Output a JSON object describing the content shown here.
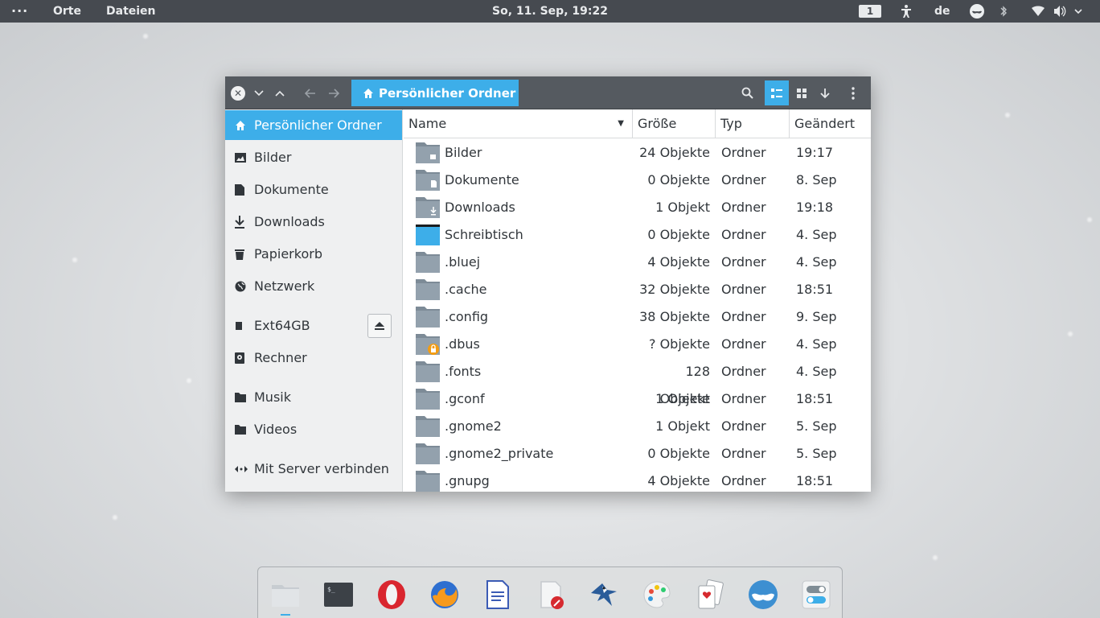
{
  "topbar": {
    "dots": "···",
    "places": "Orte",
    "files": "Dateien",
    "clock": "So, 11. Sep, 19:22",
    "workspace": "1",
    "language": "de"
  },
  "window": {
    "breadcrumb": "Persönlicher Ordner"
  },
  "sidebar": {
    "items": [
      {
        "label": "Persönlicher Ordner",
        "icon": "home-icon"
      },
      {
        "label": "Bilder",
        "icon": "image-icon"
      },
      {
        "label": "Dokumente",
        "icon": "document-icon"
      },
      {
        "label": "Downloads",
        "icon": "download-icon"
      },
      {
        "label": "Papierkorb",
        "icon": "trash-icon"
      },
      {
        "label": "Netzwerk",
        "icon": "network-icon"
      },
      {
        "label": "Ext64GB",
        "icon": "drive-icon"
      },
      {
        "label": "Rechner",
        "icon": "computer-icon"
      },
      {
        "label": "Musik",
        "icon": "folder-icon"
      },
      {
        "label": "Videos",
        "icon": "folder-icon"
      },
      {
        "label": "Mit Server verbinden",
        "icon": "connect-icon"
      }
    ]
  },
  "columns": {
    "name": "Name",
    "size": "Größe",
    "type": "Typ",
    "modified": "Geändert"
  },
  "rows": [
    {
      "name": "Bilder",
      "size": "24 Objekte",
      "type": "Ordner",
      "modified": "19:17",
      "icon": "pictures-folder-icon"
    },
    {
      "name": "Dokumente",
      "size": "0 Objekte",
      "type": "Ordner",
      "modified": "8. Sep",
      "icon": "documents-folder-icon"
    },
    {
      "name": "Downloads",
      "size": "1 Objekt",
      "type": "Ordner",
      "modified": "19:18",
      "icon": "downloads-folder-icon"
    },
    {
      "name": "Schreibtisch",
      "size": "0 Objekte",
      "type": "Ordner",
      "modified": "4. Sep",
      "icon": "desktop-folder-icon"
    },
    {
      "name": ".bluej",
      "size": "4 Objekte",
      "type": "Ordner",
      "modified": "4. Sep",
      "icon": "folder-icon"
    },
    {
      "name": ".cache",
      "size": "32 Objekte",
      "type": "Ordner",
      "modified": "18:51",
      "icon": "folder-icon"
    },
    {
      "name": ".config",
      "size": "38 Objekte",
      "type": "Ordner",
      "modified": "9. Sep",
      "icon": "folder-icon"
    },
    {
      "name": ".dbus",
      "size": "? Objekte",
      "type": "Ordner",
      "modified": "4. Sep",
      "icon": "locked-folder-icon"
    },
    {
      "name": ".fonts",
      "size": "128 Objekte",
      "type": "Ordner",
      "modified": "4. Sep",
      "icon": "folder-icon"
    },
    {
      "name": ".gconf",
      "size": "1 Objekt",
      "type": "Ordner",
      "modified": "18:51",
      "icon": "folder-icon"
    },
    {
      "name": ".gnome2",
      "size": "1 Objekt",
      "type": "Ordner",
      "modified": "5. Sep",
      "icon": "folder-icon"
    },
    {
      "name": ".gnome2_private",
      "size": "0 Objekte",
      "type": "Ordner",
      "modified": "5. Sep",
      "icon": "folder-icon"
    },
    {
      "name": ".gnupg",
      "size": "4 Objekte",
      "type": "Ordner",
      "modified": "18:51",
      "icon": "folder-icon"
    }
  ],
  "dock": [
    "files-app-icon",
    "terminal-app-icon",
    "opera-app-icon",
    "firefox-app-icon",
    "writer-app-icon",
    "text-editor-app-icon",
    "bluej-app-icon",
    "paint-app-icon",
    "solitaire-app-icon",
    "system-settings-app-icon",
    "toggle-settings-app-icon"
  ],
  "colors": {
    "accent": "#3daee9",
    "topbar": "#464a50",
    "headerbar": "#555a60",
    "folder": "#93a1ad",
    "lock": "#f39c12"
  }
}
